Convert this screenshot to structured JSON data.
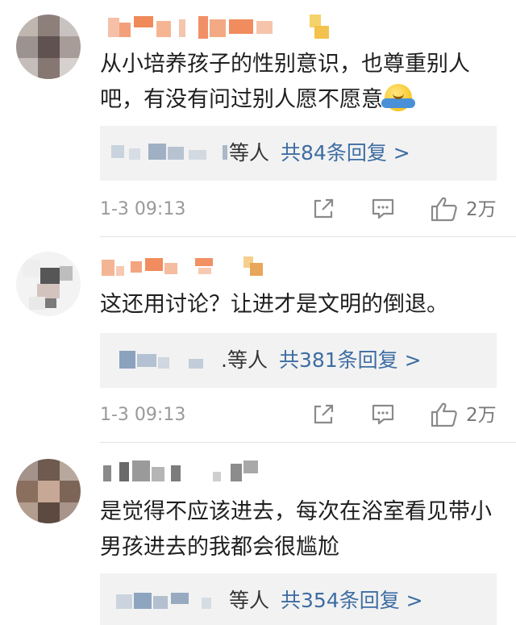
{
  "comments": [
    {
      "username_visible": false,
      "text": "从小培养孩子的性别意识，也尊重别人吧，有没有问过别人愿不愿意",
      "emoji": "shrug-emoji",
      "reply_names_suffix": "等人",
      "reply_link": "共84条回复 >",
      "time": "1-3 09:13",
      "likes": "2万"
    },
    {
      "username_visible": false,
      "text": "这还用讨论？让进才是文明的倒退。",
      "reply_names_suffix": ".等人",
      "reply_link": "共381条回复 >",
      "time": "1-3 09:13",
      "likes": "2万"
    },
    {
      "username_visible": false,
      "text": "是觉得不应该进去，每次在浴室看见带小男孩进去的我都会很尴尬",
      "reply_names_suffix": "等人",
      "reply_link": "共354条回复 >"
    }
  ],
  "icons": {
    "share": "share-icon",
    "comment": "comment-icon",
    "like": "thumbs-up-icon"
  },
  "colors": {
    "link": "#3d6da3",
    "reply_bg": "#f2f2f2",
    "meta": "#999999"
  }
}
